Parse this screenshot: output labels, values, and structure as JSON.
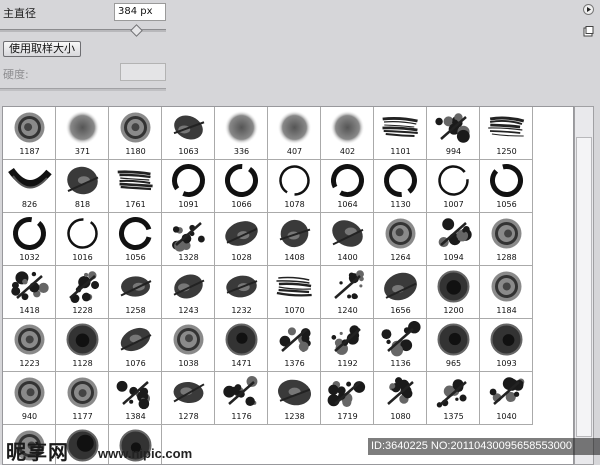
{
  "panel": {
    "diameter_label": "主直径",
    "diameter_value": "384 px",
    "diameter_slider_fraction": 0.85,
    "use_sample_size_label": "使用取样大小",
    "hardness_label": "硬度:",
    "hardness_value": ""
  },
  "presets": [
    {
      "size": "1187",
      "shape": "swirl-round"
    },
    {
      "size": "371",
      "shape": "soft-round"
    },
    {
      "size": "1180",
      "shape": "swirl-round"
    },
    {
      "size": "1063",
      "shape": "brush-blob"
    },
    {
      "size": "336",
      "shape": "soft-round"
    },
    {
      "size": "407",
      "shape": "soft-round"
    },
    {
      "size": "402",
      "shape": "soft-round"
    },
    {
      "size": "1101",
      "shape": "stroke"
    },
    {
      "size": "994",
      "shape": "splat"
    },
    {
      "size": "1250",
      "shape": "stroke"
    },
    {
      "size": "826",
      "shape": "curve"
    },
    {
      "size": "818",
      "shape": "brush-blob"
    },
    {
      "size": "1761",
      "shape": "stroke"
    },
    {
      "size": "1091",
      "shape": "ring"
    },
    {
      "size": "1066",
      "shape": "ring"
    },
    {
      "size": "1078",
      "shape": "ring-thin"
    },
    {
      "size": "1064",
      "shape": "ring"
    },
    {
      "size": "1130",
      "shape": "ring"
    },
    {
      "size": "1007",
      "shape": "ring-thin"
    },
    {
      "size": "1056",
      "shape": "ring"
    },
    {
      "size": "1032",
      "shape": "ring"
    },
    {
      "size": "1016",
      "shape": "ring-thin"
    },
    {
      "size": "1056",
      "shape": "ring"
    },
    {
      "size": "1328",
      "shape": "splat"
    },
    {
      "size": "1028",
      "shape": "brush-blob"
    },
    {
      "size": "1408",
      "shape": "brush-blob"
    },
    {
      "size": "1400",
      "shape": "brush-blob"
    },
    {
      "size": "1264",
      "shape": "swirl-round"
    },
    {
      "size": "1094",
      "shape": "splat"
    },
    {
      "size": "1288",
      "shape": "swirl-round"
    },
    {
      "size": "1418",
      "shape": "splat"
    },
    {
      "size": "1228",
      "shape": "splat"
    },
    {
      "size": "1258",
      "shape": "brush-blob"
    },
    {
      "size": "1243",
      "shape": "brush-blob"
    },
    {
      "size": "1232",
      "shape": "brush-blob"
    },
    {
      "size": "1070",
      "shape": "stroke"
    },
    {
      "size": "1240",
      "shape": "splat"
    },
    {
      "size": "1656",
      "shape": "brush-blob"
    },
    {
      "size": "1200",
      "shape": "dark-round"
    },
    {
      "size": "1184",
      "shape": "swirl-round"
    },
    {
      "size": "1223",
      "shape": "swirl-round"
    },
    {
      "size": "1128",
      "shape": "dark-round"
    },
    {
      "size": "1076",
      "shape": "brush-blob"
    },
    {
      "size": "1038",
      "shape": "swirl-round"
    },
    {
      "size": "1471",
      "shape": "dark-round"
    },
    {
      "size": "1376",
      "shape": "splat"
    },
    {
      "size": "1192",
      "shape": "splat"
    },
    {
      "size": "1136",
      "shape": "splat"
    },
    {
      "size": "965",
      "shape": "dark-round"
    },
    {
      "size": "1093",
      "shape": "dark-round"
    },
    {
      "size": "940",
      "shape": "swirl-round"
    },
    {
      "size": "1177",
      "shape": "swirl-round"
    },
    {
      "size": "1384",
      "shape": "splat"
    },
    {
      "size": "1278",
      "shape": "brush-blob"
    },
    {
      "size": "1176",
      "shape": "splat"
    },
    {
      "size": "1238",
      "shape": "brush-blob"
    },
    {
      "size": "1719",
      "shape": "splat"
    },
    {
      "size": "1080",
      "shape": "splat"
    },
    {
      "size": "1375",
      "shape": "splat"
    },
    {
      "size": "1040",
      "shape": "splat"
    },
    {
      "size": "",
      "shape": "swirl-round"
    },
    {
      "size": "",
      "shape": "dark-round"
    },
    {
      "size": "",
      "shape": "dark-round"
    }
  ],
  "watermark": {
    "site_name": "昵享网",
    "url": "www.nipic.com",
    "id_text": "ID:3640225 NO:20110430095658553000"
  },
  "icons": {
    "menu_arrow": "play-arrow-icon",
    "new_preset": "new-preset-icon"
  }
}
